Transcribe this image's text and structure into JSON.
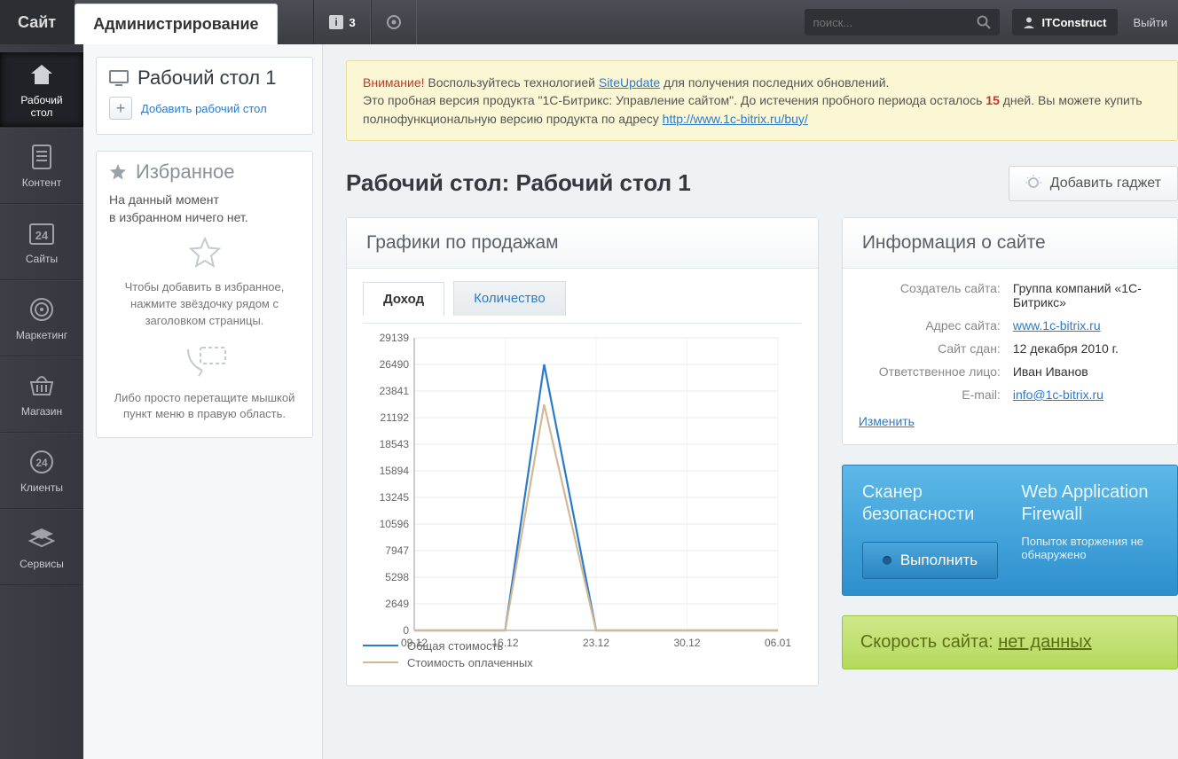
{
  "topbar": {
    "site_tab": "Сайт",
    "admin_tab": "Администрирование",
    "notif_count": "3",
    "search_placeholder": "поиск...",
    "user": "ITConstruct",
    "logout": "Выйти"
  },
  "nav": [
    {
      "label": "Рабочий\nстол",
      "icon": "home"
    },
    {
      "label": "Контент",
      "icon": "doc"
    },
    {
      "label": "Сайты",
      "icon": "cal"
    },
    {
      "label": "Маркетинг",
      "icon": "target"
    },
    {
      "label": "Магазин",
      "icon": "basket"
    },
    {
      "label": "Клиенты",
      "icon": "clients"
    },
    {
      "label": "Сервисы",
      "icon": "stack"
    }
  ],
  "sidebar": {
    "desktop_title": "Рабочий стол 1",
    "add_desktop": "Добавить рабочий стол",
    "fav_title": "Избранное",
    "fav_line1": "На данный момент",
    "fav_line2": "в избранном ничего нет.",
    "fav_hint1": "Чтобы добавить в избранное, нажмите звёздочку рядом с заголовком страницы.",
    "fav_hint2": "Либо просто перетащите мышкой пункт меню в правую область."
  },
  "notice": {
    "attn": "Внимание!",
    "p1a": " Воспользуйтесь технологией ",
    "p1link": "SiteUpdate",
    "p1b": " для получения последних обновлений.",
    "p2a": "Это пробная версия продукта \"1C-Битрикс: Управление сайтом\". До истечения пробного периода осталось ",
    "days": "15",
    "p2b": " дней. Вы можете купить полнофункциональную версию продукта по адресу ",
    "p2link": "http://www.1c-bitrix.ru/buy/"
  },
  "page": {
    "title": "Рабочий стол: Рабочий стол 1",
    "add_gadget": "Добавить гаджет"
  },
  "sales_card": {
    "title": "Графики по продажам",
    "tab_income": "Доход",
    "tab_qty": "Количество",
    "legend1": "Общая стоимость",
    "legend2": "Стоимость оплаченных"
  },
  "chart_data": {
    "type": "line",
    "x": [
      "09.12",
      "16.12",
      "23.12",
      "30.12",
      "06.01"
    ],
    "dense_x": [
      "09.12",
      "16.12",
      "19.12",
      "23.12",
      "30.12",
      "06.01"
    ],
    "series": [
      {
        "name": "Общая стоимость",
        "color": "#2a7bcb",
        "values": [
          0,
          0,
          26490,
          0,
          0,
          0
        ]
      },
      {
        "name": "Стоимость оплаченных",
        "color": "#d4b896",
        "values": [
          0,
          0,
          22500,
          0,
          0,
          0
        ]
      }
    ],
    "yticks": [
      0,
      2649,
      5298,
      7947,
      10596,
      13245,
      15894,
      18543,
      21192,
      23841,
      26490,
      29139
    ],
    "ylim": [
      0,
      29139
    ],
    "xlabel": "",
    "ylabel": ""
  },
  "info_card": {
    "title": "Информация о сайте",
    "rows": [
      {
        "label": "Создатель сайта:",
        "value": "Группа компаний «1С-Битрикс»"
      },
      {
        "label": "Адрес сайта:",
        "value": "www.1c-bitrix.ru",
        "link": true
      },
      {
        "label": "Сайт сдан:",
        "value": "12 декабря 2010 г."
      },
      {
        "label": "Ответственное лицо:",
        "value": "Иван Иванов"
      },
      {
        "label": "E-mail:",
        "value": "info@1c-bitrix.ru",
        "link": true
      }
    ],
    "edit": "Изменить"
  },
  "scanner": {
    "title": "Сканер безопасности",
    "run": "Выполнить",
    "waf_title": "Web Application Firewall",
    "waf_sub": "Попыток вторжения не обнаружено"
  },
  "speed": {
    "prefix": "Скорость сайта: ",
    "link": "нет данных"
  }
}
